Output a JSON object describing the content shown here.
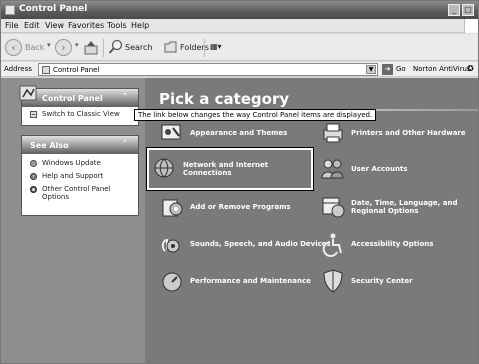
{
  "window": {
    "title": "Control Panel",
    "minimize_glyph": "_",
    "maximize_glyph": "□"
  },
  "menu": [
    "File",
    "Edit",
    "View",
    "Favorites",
    "Tools",
    "Help"
  ],
  "toolbar": {
    "back_label": "Back",
    "search_label": "Search",
    "folders_label": "Folders",
    "views_glyph": "▦▾"
  },
  "address": {
    "label": "Address",
    "value": "Control Panel",
    "go_label": "Go",
    "antivirus_label": "Norton AntiVirus"
  },
  "sidebar": {
    "control_panel": {
      "title": "Control Panel",
      "items": [
        {
          "label": "Switch to Classic View",
          "icon": "classic-view-icon"
        }
      ]
    },
    "see_also": {
      "title": "See Also",
      "items": [
        {
          "label": "Windows Update",
          "icon": "windows-update-icon"
        },
        {
          "label": "Help and Support",
          "icon": "help-icon"
        },
        {
          "label": "Other Control Panel Options",
          "icon": "options-icon"
        }
      ]
    }
  },
  "main": {
    "heading": "Pick a category",
    "tooltip": "The link below changes the way Control Panel items are displayed.",
    "categories": [
      {
        "label": "Appearance and Themes",
        "icon": "appearance-icon"
      },
      {
        "label": "Printers and Other Hardware",
        "icon": "printer-icon"
      },
      {
        "label": "Network and Internet Connections",
        "icon": "network-icon",
        "selected": true
      },
      {
        "label": "User Accounts",
        "icon": "users-icon"
      },
      {
        "label": "Add or Remove Programs",
        "icon": "add-remove-icon"
      },
      {
        "label": "Date, Time, Language, and Regional Options",
        "icon": "calendar-icon"
      },
      {
        "label": "Sounds, Speech, and Audio Devices",
        "icon": "sound-icon"
      },
      {
        "label": "Accessibility Options",
        "icon": "accessibility-icon"
      },
      {
        "label": "Performance and Maintenance",
        "icon": "performance-icon"
      },
      {
        "label": "Security Center",
        "icon": "shield-icon"
      }
    ]
  }
}
